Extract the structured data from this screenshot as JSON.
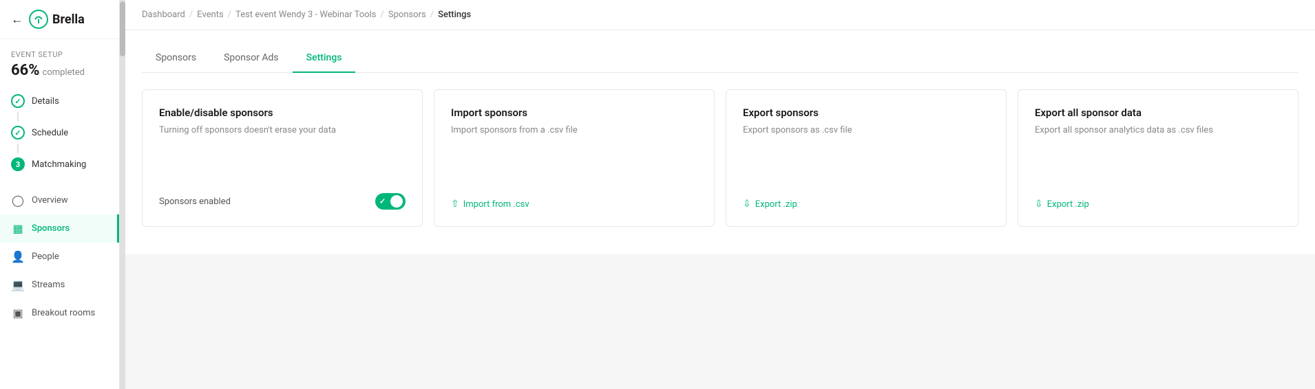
{
  "sidebar": {
    "back_icon": "←",
    "logo_text": "Brella",
    "event_setup": {
      "label": "Event Setup",
      "progress_percent": "66%",
      "progress_suffix": "completed"
    },
    "steps": [
      {
        "id": "details",
        "label": "Details",
        "type": "check"
      },
      {
        "id": "schedule",
        "label": "Schedule",
        "type": "check"
      },
      {
        "id": "matchmaking",
        "label": "Matchmaking",
        "type": "number",
        "num": "3"
      }
    ],
    "nav_items": [
      {
        "id": "overview",
        "label": "Overview",
        "icon": "○"
      },
      {
        "id": "sponsors",
        "label": "Sponsors",
        "icon": "▦",
        "active": true
      },
      {
        "id": "people",
        "label": "People",
        "icon": "👤"
      },
      {
        "id": "streams",
        "label": "Streams",
        "icon": "🖥"
      },
      {
        "id": "breakout-rooms",
        "label": "Breakout rooms",
        "icon": "⬛"
      }
    ]
  },
  "breadcrumb": {
    "items": [
      "Dashboard",
      "Events",
      "Test event Wendy 3 - Webinar Tools",
      "Sponsors",
      "Settings"
    ]
  },
  "tabs": [
    {
      "id": "sponsors",
      "label": "Sponsors"
    },
    {
      "id": "sponsor-ads",
      "label": "Sponsor Ads"
    },
    {
      "id": "settings",
      "label": "Settings",
      "active": true
    }
  ],
  "cards": [
    {
      "id": "enable-disable",
      "title": "Enable/disable sponsors",
      "description": "Turning off sponsors doesn't erase your data",
      "toggle_label": "Sponsors enabled",
      "toggle_on": true
    },
    {
      "id": "import-sponsors",
      "title": "Import sponsors",
      "description": "Import sponsors from a .csv file",
      "action_label": "Import from .csv",
      "action_icon": "↑"
    },
    {
      "id": "export-sponsors",
      "title": "Export sponsors",
      "description": "Export sponsors as .csv file",
      "action_label": "Export .zip",
      "action_icon": "↓"
    },
    {
      "id": "export-all",
      "title": "Export all sponsor data",
      "description": "Export all sponsor analytics data as .csv files",
      "action_label": "Export .zip",
      "action_icon": "↓"
    }
  ]
}
